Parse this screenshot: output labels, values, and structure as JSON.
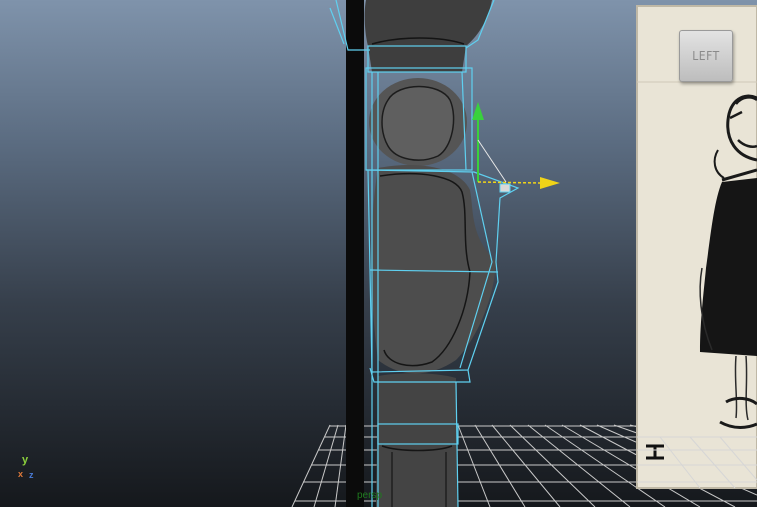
{
  "viewport": {
    "camera_name": "persp",
    "view_cube_label": "LEFT",
    "axis_labels": {
      "y": "y",
      "x": "x",
      "z": "z"
    },
    "colors": {
      "wireframe": "#5fd0f0",
      "mesh": "#5a5a5a",
      "axis_y": "#8cd13c",
      "axis_x": "#e07a3a",
      "axis_z": "#4a7bd6",
      "manipulator_y": "#39d13c",
      "manipulator_x": "#f0d418",
      "camera_label": "#1f7a1f"
    }
  }
}
